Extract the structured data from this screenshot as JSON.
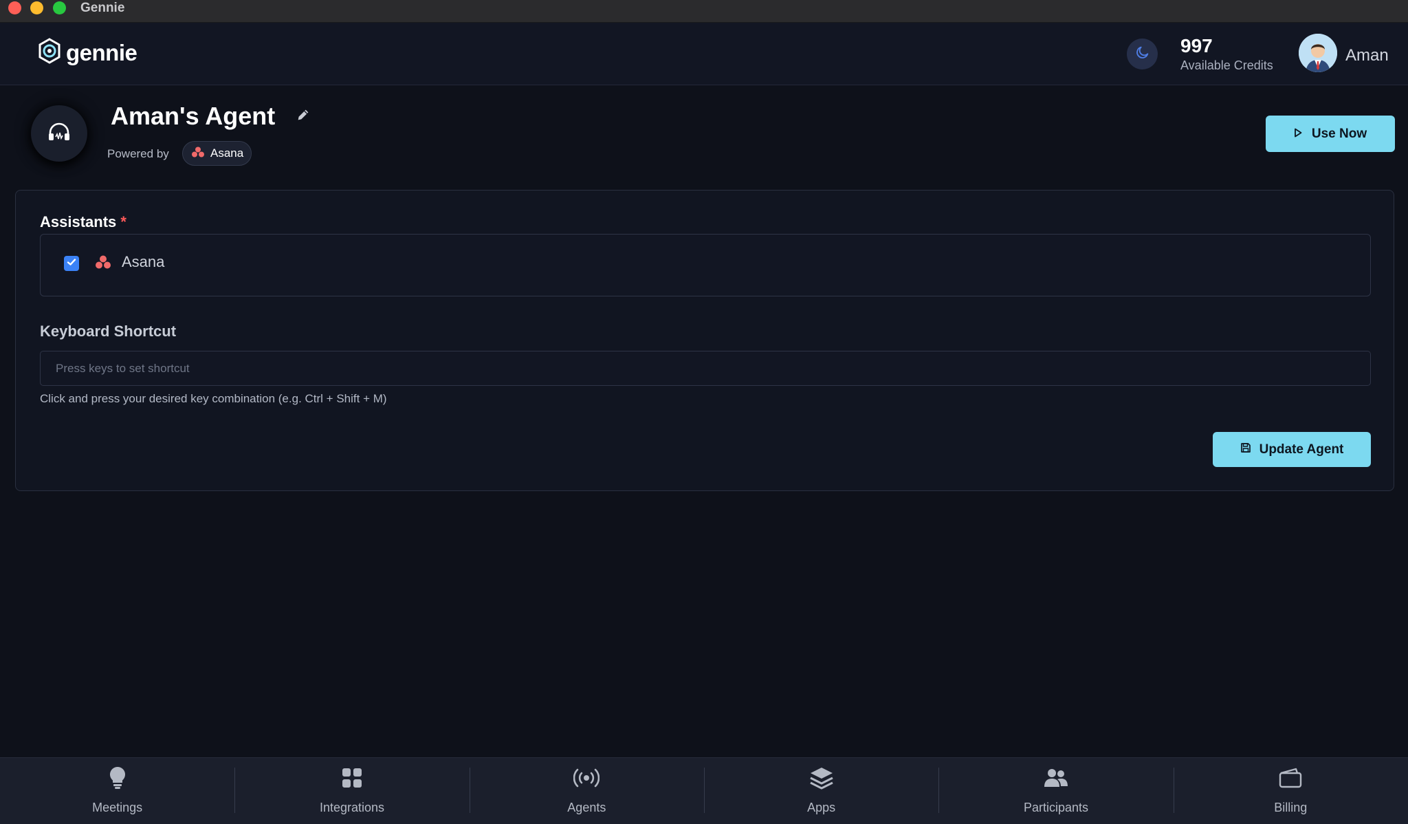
{
  "window": {
    "title": "Gennie"
  },
  "header": {
    "logo_text": "gennie",
    "credits": {
      "value": "997",
      "label": "Available Credits"
    },
    "user": {
      "name": "Aman"
    }
  },
  "agent": {
    "title": "Aman's Agent",
    "powered_by_label": "Powered by",
    "powered_by_app": "Asana",
    "use_now_label": "Use Now"
  },
  "form": {
    "assistants": {
      "label": "Assistants",
      "required_mark": "*",
      "items": [
        {
          "label": "Asana",
          "checked": true
        }
      ]
    },
    "keyboard_shortcut": {
      "label": "Keyboard Shortcut",
      "value": "",
      "placeholder": "Press keys to set shortcut",
      "help": "Click and press your desired key combination (e.g. Ctrl + Shift + M)"
    },
    "update_label": "Update Agent"
  },
  "nav": {
    "items": [
      {
        "label": "Meetings",
        "icon": "lightbulb-icon"
      },
      {
        "label": "Integrations",
        "icon": "grid-icon"
      },
      {
        "label": "Agents",
        "icon": "broadcast-icon"
      },
      {
        "label": "Apps",
        "icon": "layers-icon"
      },
      {
        "label": "Participants",
        "icon": "people-icon"
      },
      {
        "label": "Billing",
        "icon": "wallet-icon"
      }
    ]
  },
  "colors": {
    "accent": "#7cd9f0",
    "background": "#0e111a",
    "checkbox": "#3b82f6",
    "asana": "#f06a6a",
    "required": "#ff5a5a"
  }
}
